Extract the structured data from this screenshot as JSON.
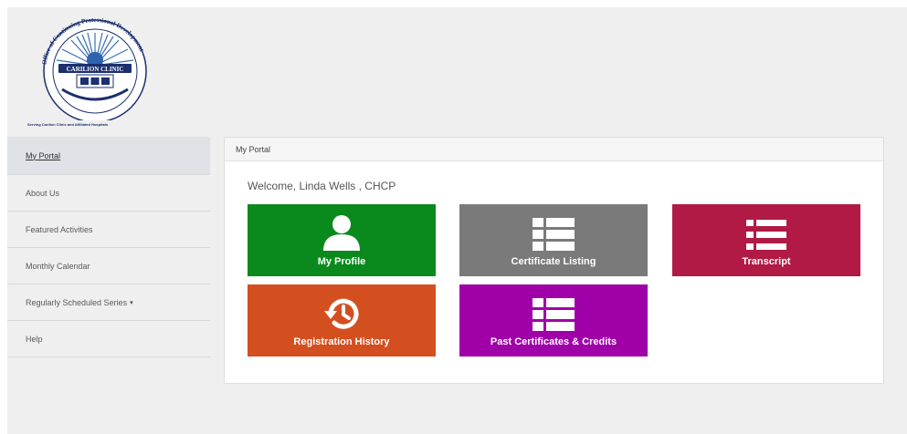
{
  "logo": {
    "ring_text": "Office of Continuing Professional Development",
    "banner_text": "CARILION CLINIC",
    "tagline": "Serving Carilion Clinic and Affiliated Hospitals"
  },
  "sidebar": {
    "items": [
      {
        "label": "My Portal",
        "active": true
      },
      {
        "label": "About Us"
      },
      {
        "label": "Featured Activities"
      },
      {
        "label": "Monthly Calendar"
      },
      {
        "label": "Regularly Scheduled Series",
        "has_dropdown": true
      },
      {
        "label": "Help"
      }
    ],
    "caret": "▾"
  },
  "panel": {
    "title": "My Portal",
    "welcome": "Welcome, Linda Wells , CHCP"
  },
  "tiles": [
    {
      "label": "My Profile",
      "icon": "user-icon",
      "color": "#0a8a1c"
    },
    {
      "label": "Certificate Listing",
      "icon": "list-icon",
      "color": "#7a7a7a"
    },
    {
      "label": "Transcript",
      "icon": "list-bullets-icon",
      "color": "#b01a45"
    },
    {
      "label": "Registration History",
      "icon": "history-icon",
      "color": "#d44f1f"
    },
    {
      "label": "Past Certificates & Credits",
      "icon": "list-icon",
      "color": "#a000a8"
    }
  ],
  "colors": {
    "background": "#efefef",
    "brand_navy": "#1c2f6e",
    "sidebar_active": "#dfe3e8"
  }
}
